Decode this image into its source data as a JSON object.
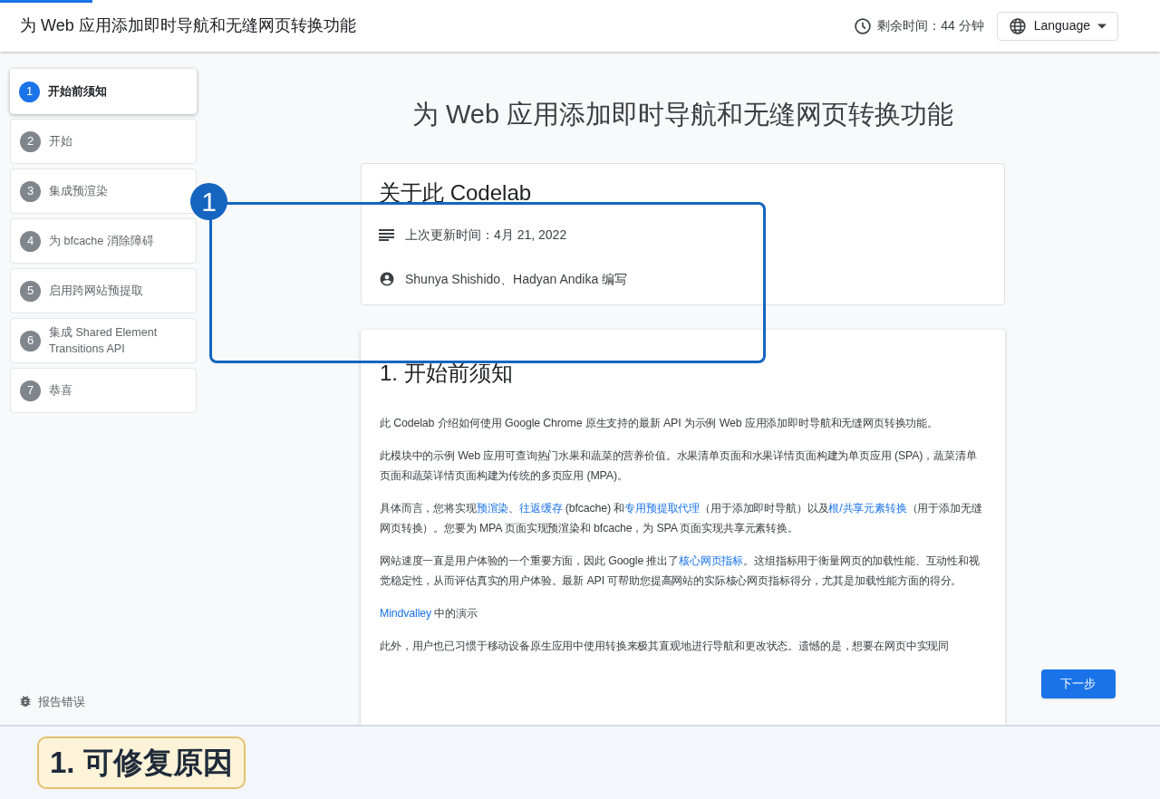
{
  "header": {
    "title": "为 Web 应用添加即时导航和无缝网页转换功能",
    "time_left": "剩余时间：44 分钟",
    "language_button": "Language",
    "progress": {
      "level": 0.08
    }
  },
  "steps": [
    {
      "number": "1",
      "label": "开始前须知",
      "selected": true
    },
    {
      "number": "2",
      "label": "开始",
      "selected": false
    },
    {
      "number": "3",
      "label": "集成预渲染",
      "selected": false
    },
    {
      "number": "4",
      "label": "为 bfcache 消除障碍",
      "selected": false
    },
    {
      "number": "5",
      "label": "启用跨网站预提取",
      "selected": false
    },
    {
      "number": "6",
      "label": "集成 Shared Element Transitions API",
      "selected": false
    },
    {
      "number": "7",
      "label": "恭喜",
      "selected": false
    }
  ],
  "report_bug": "报告错误",
  "page_title": "为 Web 应用添加即时导航和无缝网页转换功能",
  "about_card": {
    "title": "关于此 Codelab",
    "updated": "上次更新时间：4月 21, 2022",
    "authors": "Shunya Shishido、Hadyan Andika 编写"
  },
  "section": {
    "title": "1. 开始前须知",
    "paragraphs": [
      [
        {
          "text": "此 Codelab 介绍如何使用 Google Chrome 原生支持的最新 API 为示例 Web 应用添加即时导航和无缝网页转换功能。",
          "kind": "plain"
        }
      ],
      [
        {
          "text": "此模块中的示例 Web 应用可查询热门水果和蔬菜的营养价值。水果清单页面和水果详情页面构建为单页应用 (SPA)，蔬菜清单页面和蔬菜详情页面构建为传统的多页应用 (MPA)。",
          "kind": "plain"
        }
      ],
      [
        {
          "text": "具体而言，您将实现",
          "kind": "plain"
        },
        {
          "text": "预渲染",
          "kind": "link"
        },
        {
          "text": "、",
          "kind": "plain"
        },
        {
          "text": "往返缓存",
          "kind": "link"
        },
        {
          "text": " (bfcache) 和",
          "kind": "plain"
        },
        {
          "text": "专用预提取代理",
          "kind": "link"
        },
        {
          "text": "（用于添加即时导航）以及",
          "kind": "plain"
        },
        {
          "text": "根/共享元素转换",
          "kind": "link"
        },
        {
          "text": "（用于添加无缝网页转换）。您要为 MPA 页面实现预渲染和 bfcache，为 SPA 页面实现共享元素转换。",
          "kind": "plain"
        }
      ],
      [
        {
          "text": "网站速度一直是用户体验的一个重要方面，因此 Google 推出了",
          "kind": "plain"
        },
        {
          "text": "核心网页指标",
          "kind": "link"
        },
        {
          "text": "。这组指标用于衡量网页的加载性能、互动性和视觉稳定性，从而评估真实的用户体验。最新 API 可帮助您提高网站的实际核心网页指标得分，尤其是加载性能方面的得分。",
          "kind": "plain"
        }
      ],
      [
        {
          "text": "Mindvalley",
          "kind": "link"
        },
        {
          "text": " 中的演示",
          "kind": "plain"
        }
      ],
      [
        {
          "text": "此外，用户也已习惯于移动设备原生应用中使用转换来极其直观地进行导航和更改状态。遗憾的是，想要在网页中实现同",
          "kind": "plain"
        }
      ]
    ]
  },
  "next_button": "下一步",
  "annotation": {
    "marker": "1",
    "caption": "1. 可修复原因"
  }
}
